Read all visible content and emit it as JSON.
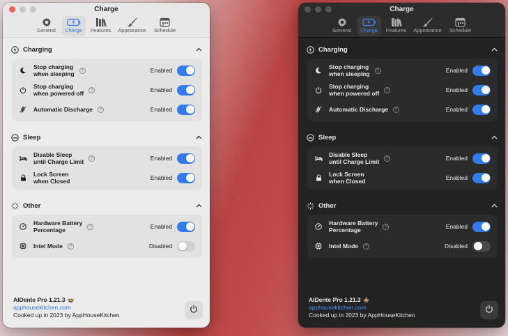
{
  "colors": {
    "accent": "#2f7cf6",
    "close_red": "#ff5f57"
  },
  "window": {
    "title": "Charge"
  },
  "tabs": [
    {
      "label": "General",
      "icon": "gear-icon"
    },
    {
      "label": "Charge",
      "icon": "battery-icon"
    },
    {
      "label": "Features",
      "icon": "books-icon"
    },
    {
      "label": "Appearance",
      "icon": "paintbrush-icon"
    },
    {
      "label": "Schedule",
      "icon": "calendar-icon"
    }
  ],
  "sections": {
    "charging": {
      "title": "Charging",
      "rows": [
        {
          "label1": "Stop charging",
          "label2": "when sleeping",
          "status": "Enabled",
          "on": true
        },
        {
          "label1": "Stop charging",
          "label2": "when powered off",
          "status": "Enabled",
          "on": true
        },
        {
          "label1": "Automatic Discharge",
          "label2": "",
          "status": "Enabled",
          "on": true
        }
      ]
    },
    "sleep": {
      "title": "Sleep",
      "rows": [
        {
          "label1": "Disable Sleep",
          "label2": "until Charge Limit",
          "status": "Enabled",
          "on": true
        },
        {
          "label1": "Lock Screen",
          "label2": "when Closed",
          "status": "Enabled",
          "on": true
        }
      ]
    },
    "other": {
      "title": "Other",
      "rows": [
        {
          "label1": "Hardware Battery",
          "label2": "Percentage",
          "status": "Enabled",
          "on": true
        },
        {
          "label1": "Intel Mode",
          "label2": "",
          "status": "Disabled",
          "on": false
        }
      ]
    }
  },
  "footer": {
    "version": "AlDente Pro 1.21.3",
    "link": "apphousekitchen.com",
    "credit": "Cooked up in 2023 by AppHouseKitchen"
  }
}
